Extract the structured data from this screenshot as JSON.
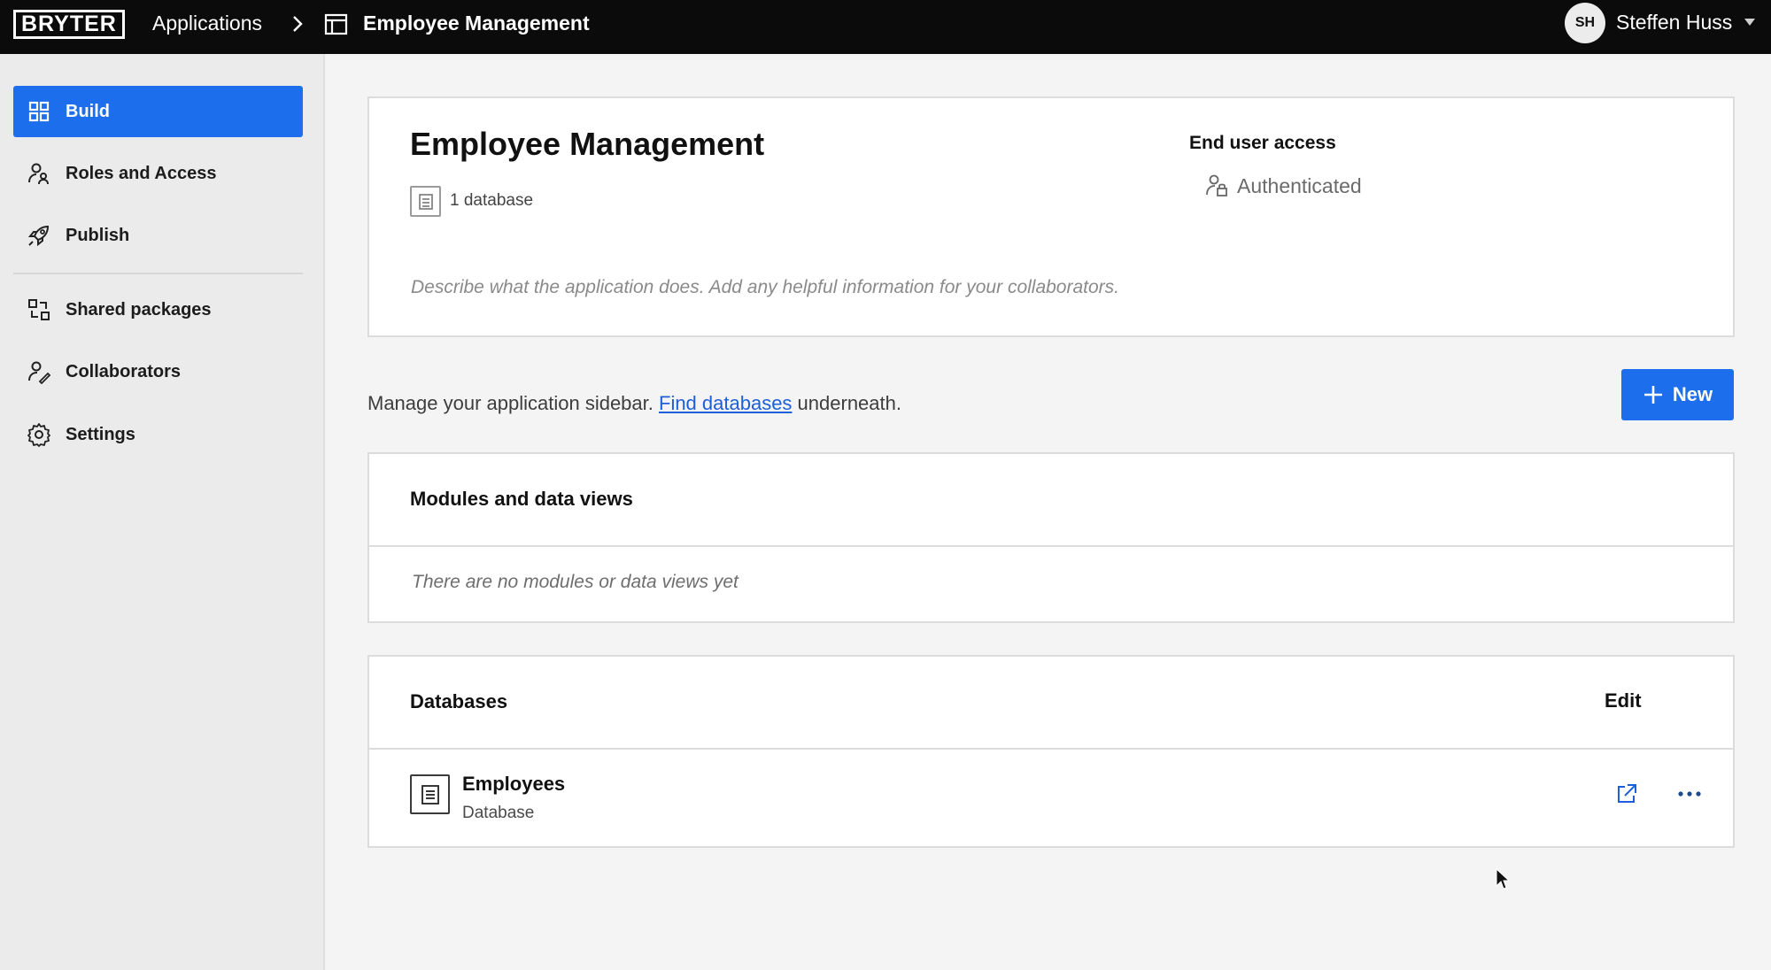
{
  "topbar": {
    "logo": "BRYTER",
    "breadcrumb_parent": "Applications",
    "breadcrumb_current": "Employee Management",
    "user_initials": "SH",
    "user_name": "Steffen Huss"
  },
  "sidebar": {
    "items": [
      {
        "label": "Build",
        "icon": "grid-icon",
        "active": true
      },
      {
        "label": "Roles and Access",
        "icon": "users-icon"
      },
      {
        "label": "Publish",
        "icon": "rocket-icon"
      },
      {
        "label": "Shared packages",
        "icon": "packages-icon"
      },
      {
        "label": "Collaborators",
        "icon": "collaborators-icon"
      },
      {
        "label": "Settings",
        "icon": "gear-icon"
      }
    ]
  },
  "app": {
    "title": "Employee Management",
    "database_count": "1 database",
    "access_heading": "End user access",
    "access_value": "Authenticated",
    "description_placeholder": "Describe what the application does. Add any helpful information for your collaborators."
  },
  "manage": {
    "text_before": "Manage your application sidebar. ",
    "link": "Find databases",
    "text_after": " underneath.",
    "new_button": "New"
  },
  "modules": {
    "title": "Modules and data views",
    "empty": "There are no modules or data views yet"
  },
  "databases": {
    "title": "Databases",
    "edit": "Edit",
    "rows": [
      {
        "name": "Employees",
        "type": "Database"
      }
    ]
  },
  "colors": {
    "accent": "#1d6eed",
    "topbar": "#0b0b0b",
    "sidebar": "#ebebeb",
    "link": "#1d5fd6"
  }
}
